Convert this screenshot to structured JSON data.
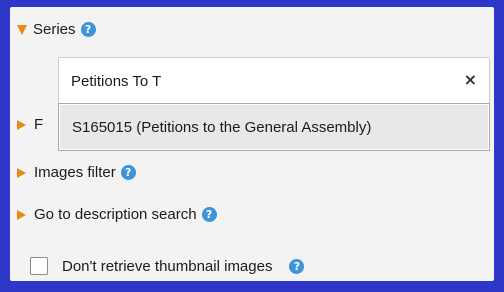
{
  "filters": {
    "series": {
      "label": "Series",
      "help_icon": "question-circle-icon",
      "search": {
        "value": "Petitions To T",
        "clear_icon": "close-icon",
        "clear_glyph": "×"
      },
      "suggestions": [
        "S165015 (Petitions to the General Assembly)"
      ]
    },
    "hidden_row_partial": "F",
    "images_filter": {
      "label": "Images filter",
      "help_icon": "question-circle-icon"
    },
    "description_search": {
      "label": "Go to description search",
      "help_icon": "question-circle-icon"
    },
    "thumbnails": {
      "label": "Don't retrieve thumbnail images",
      "checked": false,
      "help_icon": "question-circle-icon"
    }
  },
  "colors": {
    "frame_border": "#2f37c8",
    "panel_bg": "#f3f3f3",
    "expand_arrow": "#e88a1b",
    "help_icon": "#3f93d8",
    "highlight_option": "#e8e8e8"
  }
}
